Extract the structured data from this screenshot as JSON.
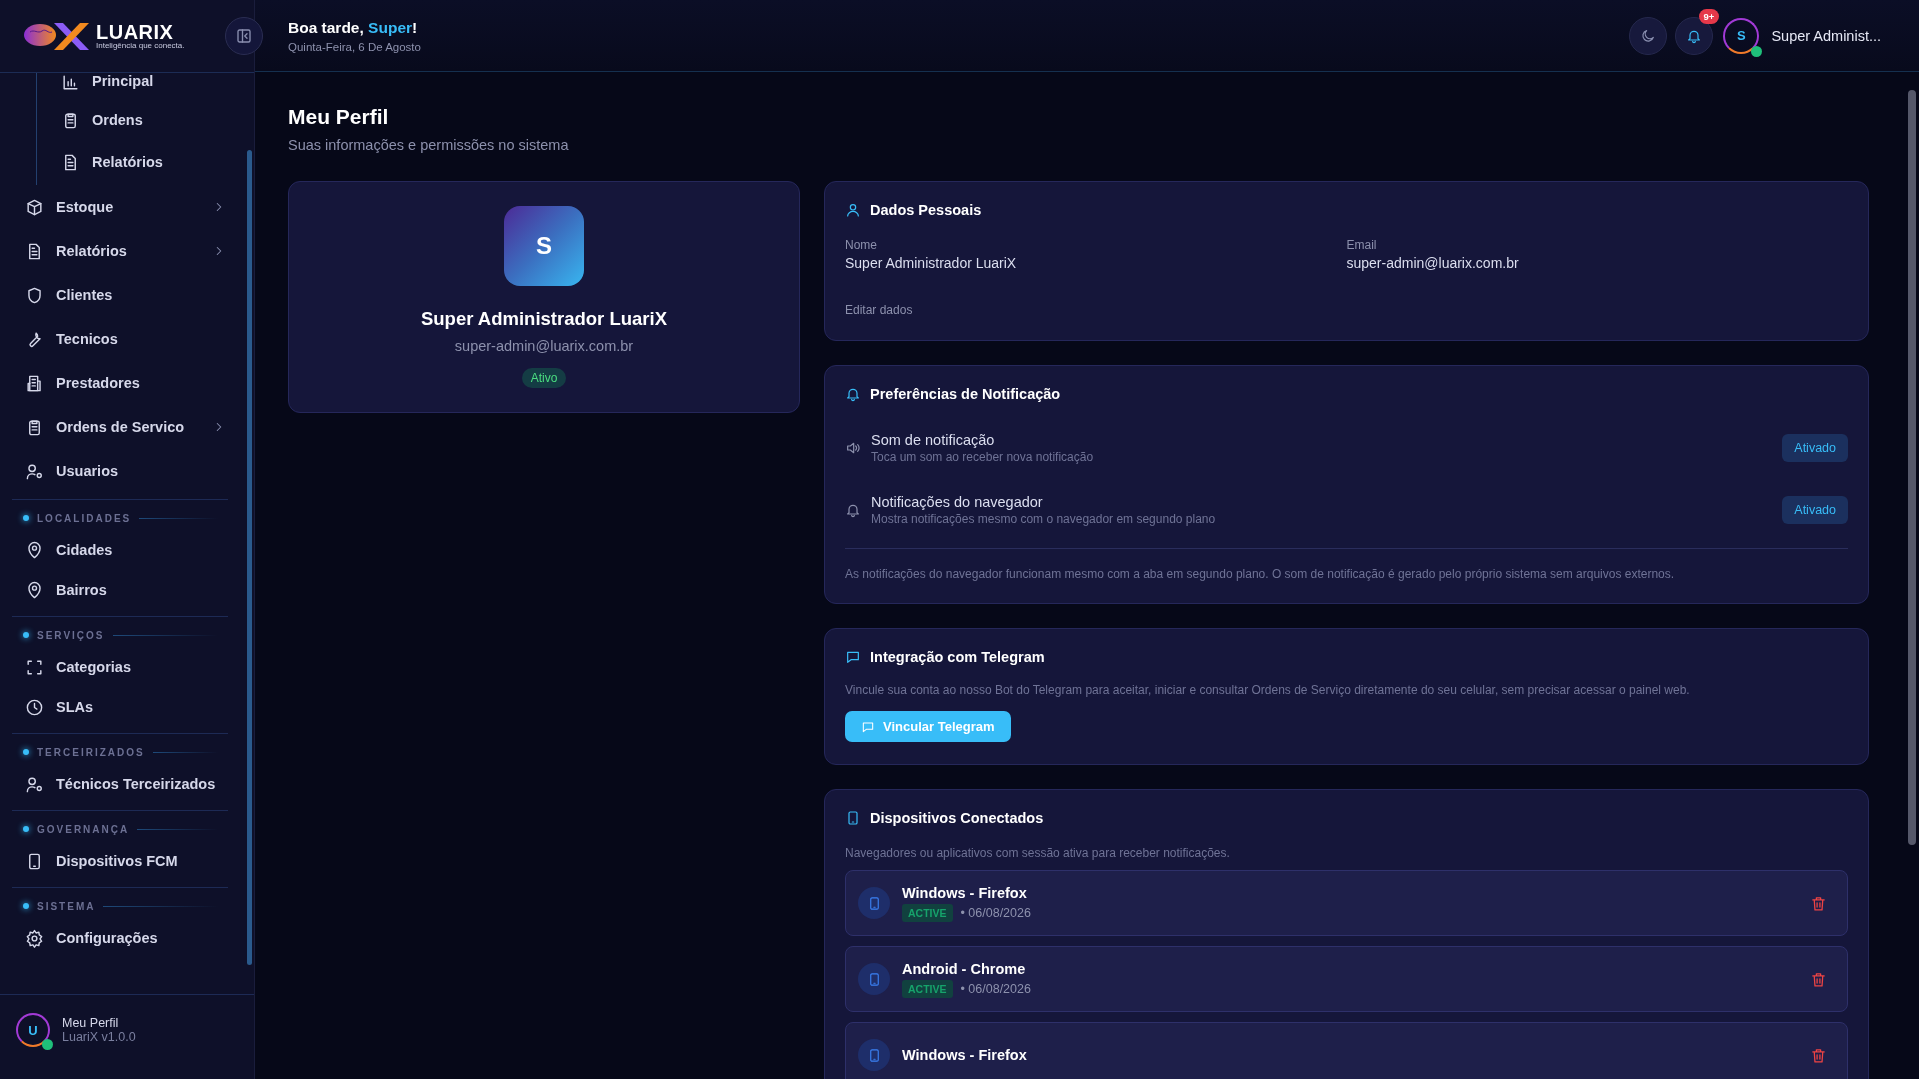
{
  "sidebar": {
    "logo": {
      "wordmark": "LUARIX",
      "tagline": "Inteligência que conecta."
    },
    "submenu": [
      {
        "label": "Principal"
      },
      {
        "label": "Ordens"
      },
      {
        "label": "Relatórios"
      }
    ],
    "items": [
      {
        "label": "Estoque",
        "has_submenu": true
      },
      {
        "label": "Relatórios",
        "has_submenu": true
      },
      {
        "label": "Clientes",
        "has_submenu": false
      },
      {
        "label": "Tecnicos",
        "has_submenu": false
      },
      {
        "label": "Prestadores",
        "has_submenu": false
      },
      {
        "label": "Ordens de Servico",
        "has_submenu": true
      },
      {
        "label": "Usuarios",
        "has_submenu": false
      }
    ],
    "sections": [
      {
        "heading": "LOCALIDADES",
        "items": [
          {
            "label": "Cidades",
            "has_submenu": false
          },
          {
            "label": "Bairros",
            "has_submenu": false
          }
        ]
      },
      {
        "heading": "SERVIÇOS",
        "items": [
          {
            "label": "Categorias",
            "has_submenu": false
          },
          {
            "label": "SLAs",
            "has_submenu": false
          }
        ]
      },
      {
        "heading": "TERCEIRIZADOS",
        "items": [
          {
            "label": "Técnicos Terceirizados",
            "has_submenu": false
          }
        ]
      },
      {
        "heading": "GOVERNANÇA",
        "items": [
          {
            "label": "Dispositivos FCM",
            "has_submenu": false
          }
        ]
      },
      {
        "heading": "SISTEMA",
        "items": [
          {
            "label": "Configurações",
            "has_submenu": false
          }
        ]
      }
    ],
    "footer": {
      "avatar": "U",
      "title": "Meu Perfil",
      "version": "LuariX v1.0.0"
    }
  },
  "header": {
    "greeting": {
      "prefix": "Boa tarde, ",
      "name": "Super",
      "suffix": "!"
    },
    "date": "Quinta-Feira, 6 De Agosto",
    "notification_count": "9+",
    "user": {
      "avatar": "S",
      "name": "Super Administ..."
    }
  },
  "page": {
    "title": "Meu Perfil",
    "subtitle": "Suas informações e permissões no sistema"
  },
  "profile_card": {
    "avatar": "S",
    "name": "Super Administrador LuariX",
    "email": "super-admin@luarix.com.br",
    "status": "Ativo"
  },
  "personal_data": {
    "title": "Dados Pessoais",
    "fields": [
      {
        "label": "Nome",
        "value": "Super Administrador LuariX"
      },
      {
        "label": "Email",
        "value": "super-admin@luarix.com.br"
      }
    ],
    "edit_link": "Editar dados"
  },
  "notification_preferences": {
    "title": "Preferências de Notificação",
    "options": [
      {
        "title": "Som de notificação",
        "description": "Toca um som ao receber nova notificação",
        "button": "Ativado"
      },
      {
        "title": "Notificações do navegador",
        "description": "Mostra notificações mesmo com o navegador em segundo plano",
        "button": "Ativado"
      }
    ],
    "note": "As notificações do navegador funcionam mesmo com a aba em segundo plano. O som de notificação é gerado pelo próprio sistema sem arquivos externos."
  },
  "telegram": {
    "title": "Integração com Telegram",
    "description": "Vincule sua conta ao nosso Bot do Telegram para aceitar, iniciar e consultar Ordens de Serviço diretamente do seu celular, sem precisar acessar o painel web.",
    "button": "Vincular Telegram"
  },
  "devices": {
    "title": "Dispositivos Conectados",
    "description": "Navegadores ou aplicativos com sessão ativa para receber notificações.",
    "items": [
      {
        "name": "Windows - Firefox",
        "status": "ACTIVE",
        "date": "• 06/08/2026"
      },
      {
        "name": "Android - Chrome",
        "status": "ACTIVE",
        "date": "• 06/08/2026"
      },
      {
        "name": "Windows - Firefox"
      }
    ]
  }
}
